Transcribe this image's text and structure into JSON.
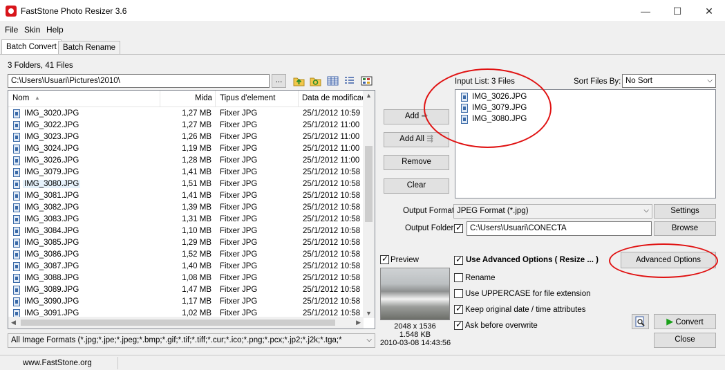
{
  "window": {
    "title": "FastStone Photo Resizer 3.6",
    "minimize": "—",
    "maximize": "☐",
    "close": "✕"
  },
  "menu": [
    "File",
    "Skin",
    "Help"
  ],
  "tabs": [
    "Batch Convert",
    "Batch Rename"
  ],
  "folder_summary": "3 Folders, 41 Files",
  "path": {
    "value": "C:\\Users\\Usuari\\Pictures\\2010\\",
    "browse_label": "..."
  },
  "columns": {
    "name": "Nom",
    "size": "Mida",
    "type": "Tipus d'element",
    "date": "Data de modificaci"
  },
  "files": [
    {
      "name": "IMG_3020.JPG",
      "size": "1,27 MB",
      "type": "Fitxer JPG",
      "date": "25/1/2012 10:59"
    },
    {
      "name": "IMG_3022.JPG",
      "size": "1,27 MB",
      "type": "Fitxer JPG",
      "date": "25/1/2012 11:00"
    },
    {
      "name": "IMG_3023.JPG",
      "size": "1,26 MB",
      "type": "Fitxer JPG",
      "date": "25/1/2012 11:00"
    },
    {
      "name": "IMG_3024.JPG",
      "size": "1,19 MB",
      "type": "Fitxer JPG",
      "date": "25/1/2012 11:00"
    },
    {
      "name": "IMG_3026.JPG",
      "size": "1,28 MB",
      "type": "Fitxer JPG",
      "date": "25/1/2012 11:00"
    },
    {
      "name": "IMG_3079.JPG",
      "size": "1,41 MB",
      "type": "Fitxer JPG",
      "date": "25/1/2012 10:58"
    },
    {
      "name": "IMG_3080.JPG",
      "size": "1,51 MB",
      "type": "Fitxer JPG",
      "date": "25/1/2012 10:58"
    },
    {
      "name": "IMG_3081.JPG",
      "size": "1,41 MB",
      "type": "Fitxer JPG",
      "date": "25/1/2012 10:58"
    },
    {
      "name": "IMG_3082.JPG",
      "size": "1,39 MB",
      "type": "Fitxer JPG",
      "date": "25/1/2012 10:58"
    },
    {
      "name": "IMG_3083.JPG",
      "size": "1,31 MB",
      "type": "Fitxer JPG",
      "date": "25/1/2012 10:58"
    },
    {
      "name": "IMG_3084.JPG",
      "size": "1,10 MB",
      "type": "Fitxer JPG",
      "date": "25/1/2012 10:58"
    },
    {
      "name": "IMG_3085.JPG",
      "size": "1,29 MB",
      "type": "Fitxer JPG",
      "date": "25/1/2012 10:58"
    },
    {
      "name": "IMG_3086.JPG",
      "size": "1,52 MB",
      "type": "Fitxer JPG",
      "date": "25/1/2012 10:58"
    },
    {
      "name": "IMG_3087.JPG",
      "size": "1,40 MB",
      "type": "Fitxer JPG",
      "date": "25/1/2012 10:58"
    },
    {
      "name": "IMG_3088.JPG",
      "size": "1,08 MB",
      "type": "Fitxer JPG",
      "date": "25/1/2012 10:58"
    },
    {
      "name": "IMG_3089.JPG",
      "size": "1,47 MB",
      "type": "Fitxer JPG",
      "date": "25/1/2012 10:58"
    },
    {
      "name": "IMG_3090.JPG",
      "size": "1,17 MB",
      "type": "Fitxer JPG",
      "date": "25/1/2012 10:58"
    },
    {
      "name": "IMG_3091.JPG",
      "size": "1,02 MB",
      "type": "Fitxer JPG",
      "date": "25/1/2012 10:58"
    }
  ],
  "selected_file": "IMG_3080.JPG",
  "filter": "All Image Formats (*.jpg;*.jpe;*.jpeg;*.bmp;*.gif;*.tif;*.tiff;*.cur;*.ico;*.png;*.pcx;*.jp2;*.j2k;*.tga;*",
  "buttons": {
    "add": "Add",
    "add_all": "Add All",
    "remove": "Remove",
    "clear": "Clear",
    "settings": "Settings",
    "browse": "Browse",
    "advanced": "Advanced Options",
    "convert": "Convert",
    "close": "Close"
  },
  "input_list": {
    "label": "Input List:  3 Files",
    "files": [
      "IMG_3026.JPG",
      "IMG_3079.JPG",
      "IMG_3080.JPG"
    ]
  },
  "sort": {
    "label": "Sort Files By:",
    "value": "No Sort"
  },
  "output_format": {
    "label": "Output Format:",
    "value": "JPEG Format (*.jpg)"
  },
  "output_folder": {
    "label": "Output Folder:",
    "value": "C:\\Users\\Usuari\\CONECTA",
    "checked": true
  },
  "preview": {
    "label": "Preview",
    "checked": true,
    "dimensions": "2048 x 1536",
    "size": "1.548 KB",
    "date": "2010-03-08 14:43:56"
  },
  "options": [
    {
      "label": "Use Advanced Options ( Resize ... )",
      "checked": true
    },
    {
      "label": "Rename",
      "checked": false
    },
    {
      "label": "Use UPPERCASE for file extension",
      "checked": false
    },
    {
      "label": "Keep original date / time attributes",
      "checked": true
    },
    {
      "label": "Ask before overwrite",
      "checked": true
    }
  ],
  "status": "www.FastStone.org",
  "colors": {
    "annotation": "#e01212",
    "convert_icon": "#1aa11a",
    "selection": "#e5f1fb"
  },
  "icons": [
    "folder-up-icon",
    "refresh-icon",
    "view-details-icon",
    "view-list-icon",
    "view-thumbnails-icon",
    "preview-icon",
    "play-icon"
  ]
}
